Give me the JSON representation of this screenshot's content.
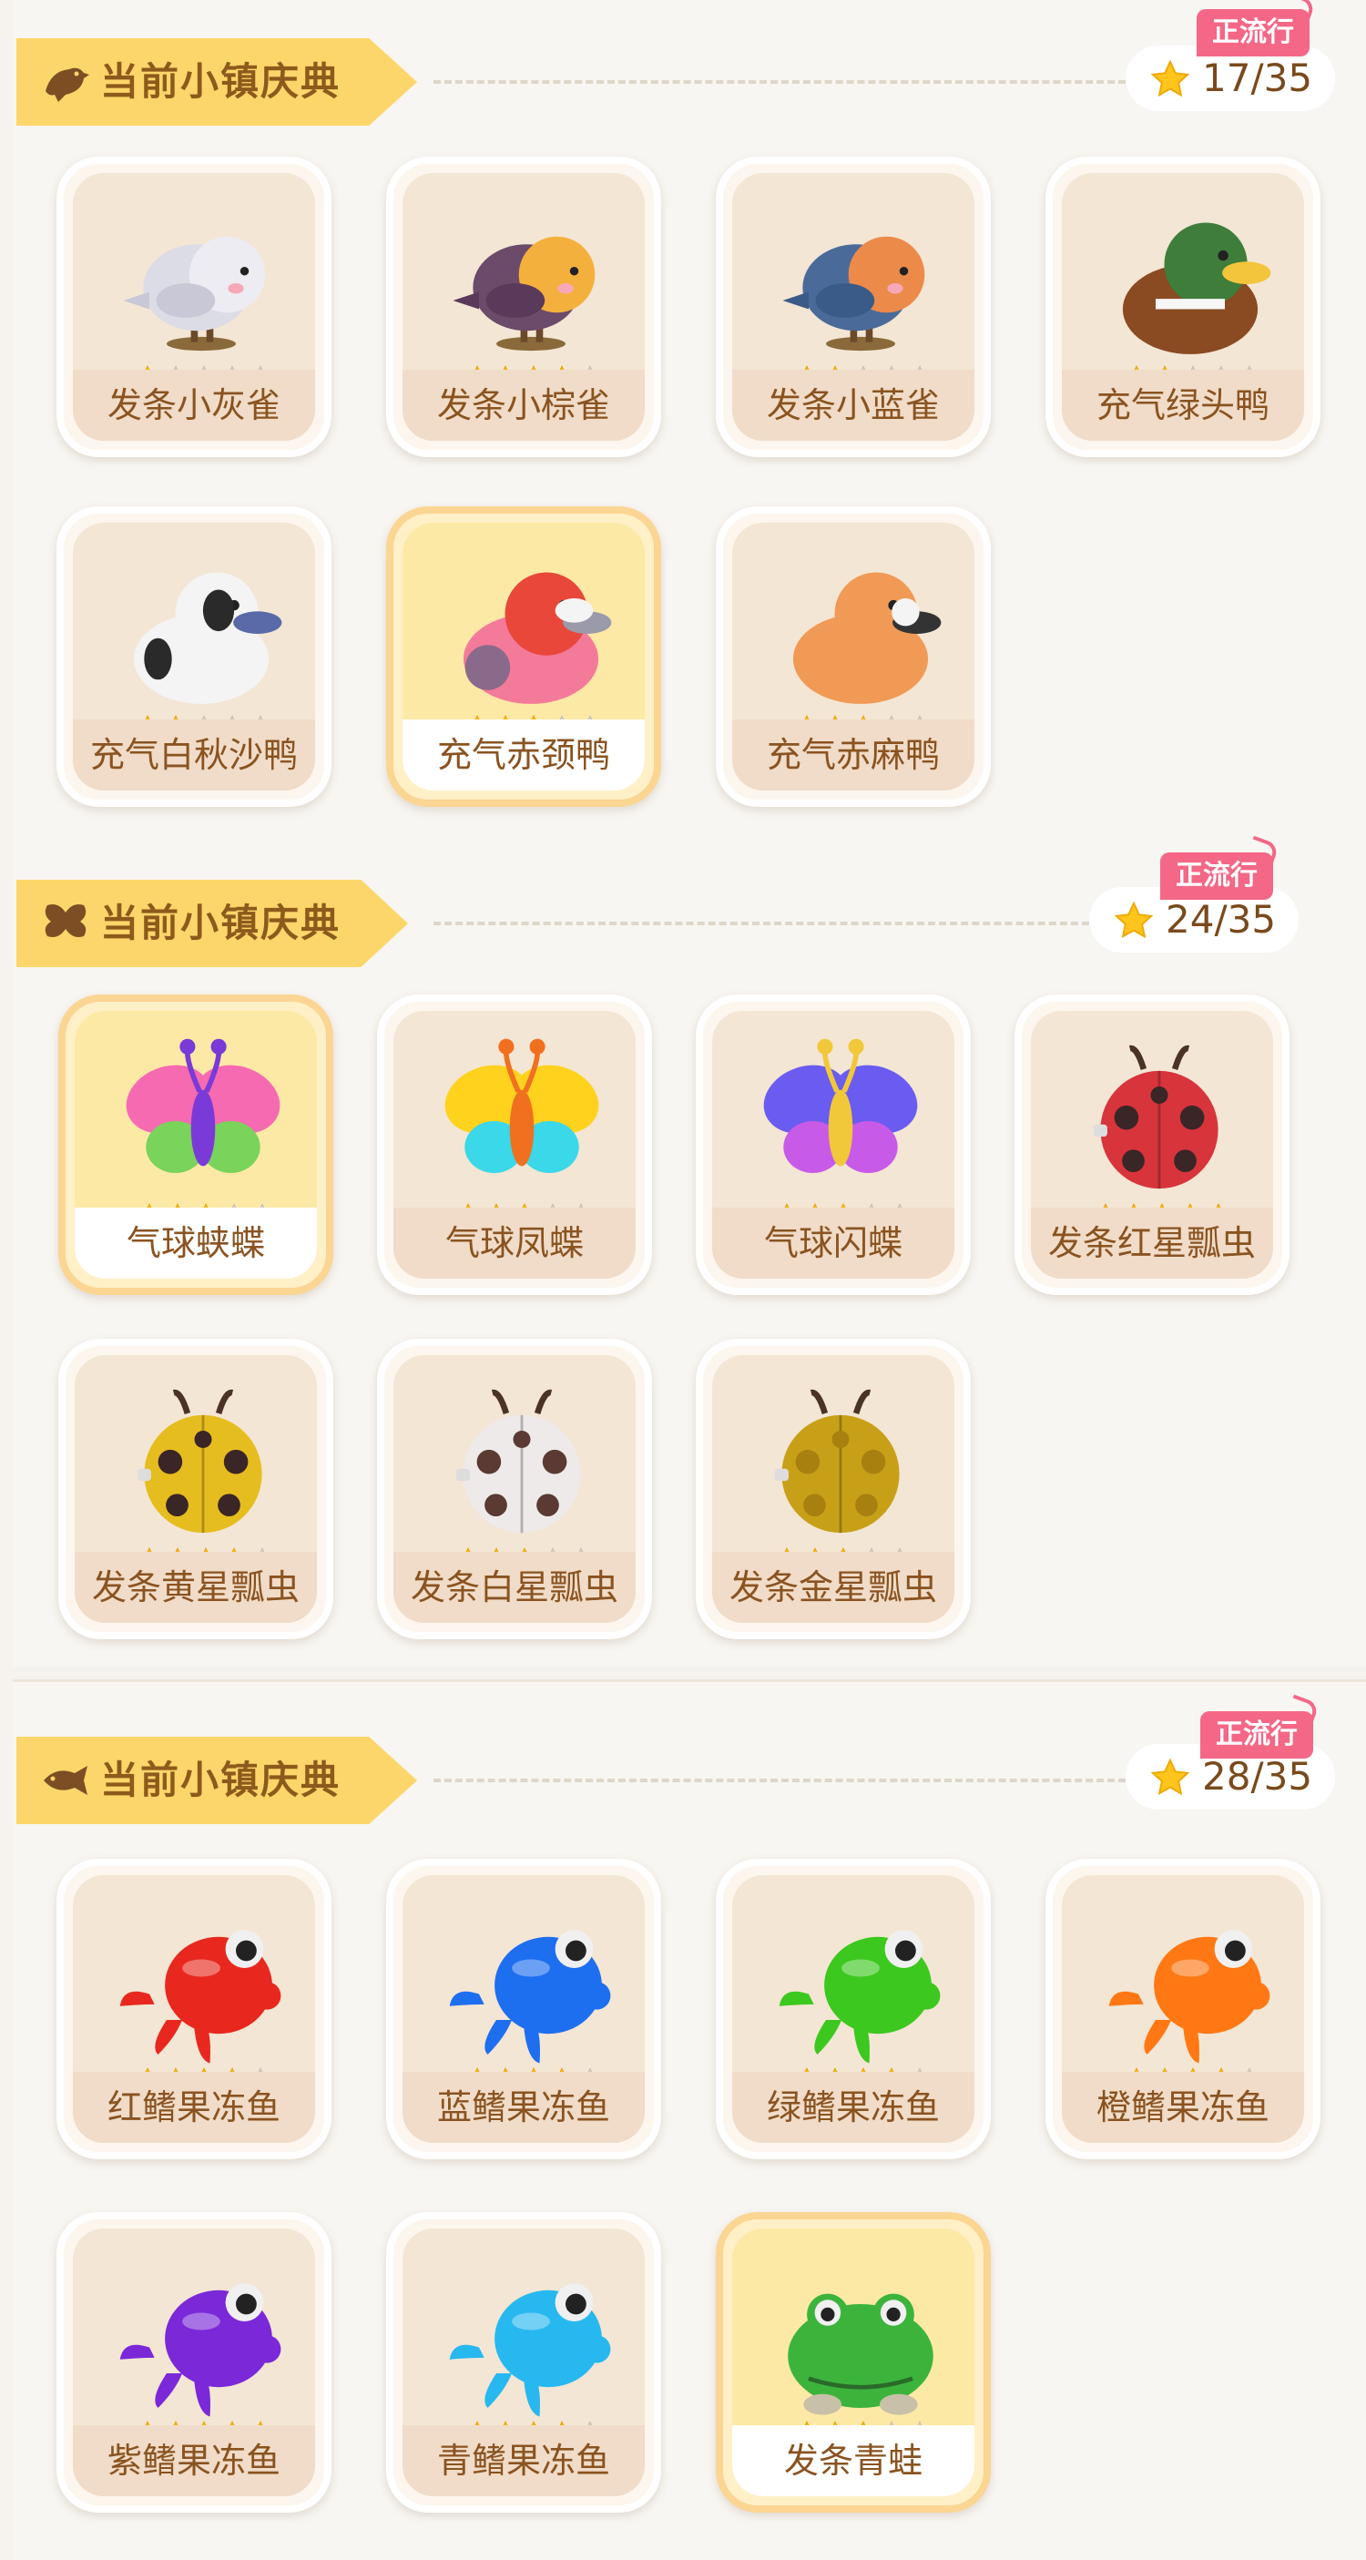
{
  "sections": [
    {
      "header": {
        "title": "当前小镇庆典",
        "icon": "bird-icon",
        "trend_badge": "正流行",
        "count": "17/35"
      },
      "items": [
        {
          "name": "发条小灰雀",
          "stars": 1,
          "art": "gray-sparrow",
          "selected": false
        },
        {
          "name": "发条小棕雀",
          "stars": 4,
          "art": "brown-sparrow",
          "selected": false
        },
        {
          "name": "发条小蓝雀",
          "stars": 2,
          "art": "blue-sparrow",
          "selected": false
        },
        {
          "name": "充气绿头鸭",
          "stars": 2,
          "art": "mallard",
          "selected": false
        },
        {
          "name": "充气白秋沙鸭",
          "stars": 2,
          "art": "smew",
          "selected": false
        },
        {
          "name": "充气赤颈鸭",
          "stars": 3,
          "art": "wigeon",
          "selected": true
        },
        {
          "name": "充气赤麻鸭",
          "stars": 3,
          "art": "shelduck",
          "selected": false
        }
      ]
    },
    {
      "header": {
        "title": "当前小镇庆典",
        "icon": "butterfly-icon",
        "trend_badge": "正流行",
        "count": "24/35"
      },
      "items": [
        {
          "name": "气球蛱蝶",
          "stars": 3,
          "art": "butterfly-pink",
          "selected": true
        },
        {
          "name": "气球凤蝶",
          "stars": 3,
          "art": "butterfly-yellow",
          "selected": false
        },
        {
          "name": "气球闪蝶",
          "stars": 3,
          "art": "butterfly-blue",
          "selected": false
        },
        {
          "name": "发条红星瓢虫",
          "stars": 5,
          "art": "ladybug-red",
          "selected": false
        },
        {
          "name": "发条黄星瓢虫",
          "stars": 4,
          "art": "ladybug-yellow",
          "selected": false
        },
        {
          "name": "发条白星瓢虫",
          "stars": 3,
          "art": "ladybug-white",
          "selected": false
        },
        {
          "name": "发条金星瓢虫",
          "stars": 3,
          "art": "ladybug-gold",
          "selected": false
        }
      ]
    },
    {
      "header": {
        "title": "当前小镇庆典",
        "icon": "fish-icon",
        "trend_badge": "正流行",
        "count": "28/35"
      },
      "items": [
        {
          "name": "红鳍果冻鱼",
          "stars": 4,
          "art": "fish-red",
          "selected": false
        },
        {
          "name": "蓝鳍果冻鱼",
          "stars": 4,
          "art": "fish-blue",
          "selected": false
        },
        {
          "name": "绿鳍果冻鱼",
          "stars": 4,
          "art": "fish-green",
          "selected": false
        },
        {
          "name": "橙鳍果冻鱼",
          "stars": 4,
          "art": "fish-orange",
          "selected": false
        },
        {
          "name": "紫鳍果冻鱼",
          "stars": 5,
          "art": "fish-purple",
          "selected": false
        },
        {
          "name": "青鳍果冻鱼",
          "stars": 4,
          "art": "fish-cyan",
          "selected": false
        },
        {
          "name": "发条青蛙",
          "stars": 3,
          "art": "frog-green",
          "selected": true
        }
      ]
    }
  ],
  "colors": {
    "sparrow_gray": "#dcdce6",
    "sparrow_brown": "#6b4a6a",
    "sparrow_blue": "#4a6a9a",
    "mallard_head": "#3f7d3a",
    "mallard_body": "#8a4a22",
    "wigeon_head": "#e8473a",
    "wigeon_body": "#f47a9a",
    "shelduck": "#f09a55",
    "butterfly_pink": "#f56ab0",
    "butterfly_yellow": "#ffd21e",
    "butterfly_blue": "#6a5cf0",
    "ladybug_red": "#d8343c",
    "ladybug_yellow": "#e6bd1f",
    "ladybug_white": "#eeeaea",
    "ladybug_gold": "#c8a018",
    "fish_red": "#e8281e",
    "fish_blue": "#1e6ef0",
    "fish_green": "#3cc81e",
    "fish_orange": "#ff7814",
    "fish_purple": "#7a28d8",
    "fish_cyan": "#28b8f0",
    "frog": "#3cb43c"
  }
}
